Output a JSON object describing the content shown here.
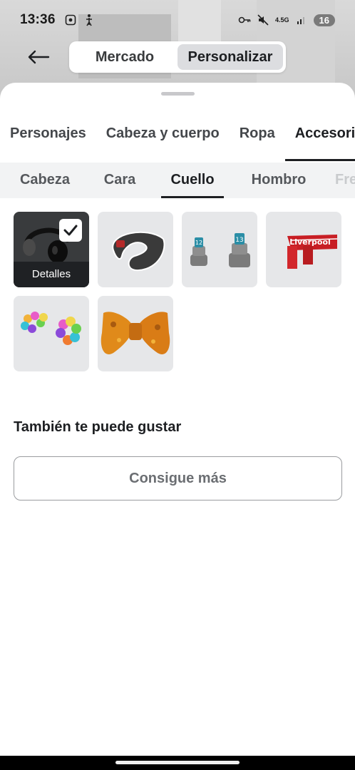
{
  "status_bar": {
    "time": "13:36",
    "network": "4.5G",
    "battery": "16"
  },
  "top_nav": {
    "segments": [
      "Mercado",
      "Personalizar"
    ],
    "active_segment": "Personalizar"
  },
  "category_tabs": [
    "Personajes",
    "Cabeza y cuerpo",
    "Ropa",
    "Accesorios"
  ],
  "active_category": "Accesorios",
  "sub_tabs": [
    "Cabeza",
    "Cara",
    "Cuello",
    "Hombro",
    "Frente"
  ],
  "active_sub_tab": "Cuello",
  "items": [
    {
      "name": "headphones",
      "selected": true,
      "details_label": "Detalles"
    },
    {
      "name": "neck-pillow",
      "selected": false
    },
    {
      "name": "cakes",
      "selected": false
    },
    {
      "name": "scarf",
      "selected": false,
      "text": "Liverpool"
    },
    {
      "name": "balloons",
      "selected": false
    },
    {
      "name": "bow-tie",
      "selected": false
    }
  ],
  "recommend": {
    "heading": "También te puede gustar",
    "button": "Consigue más"
  },
  "colors": {
    "selected_tile": "#393b3d",
    "tile_bg": "#e6e7e9",
    "accent": "#1d1f22"
  }
}
